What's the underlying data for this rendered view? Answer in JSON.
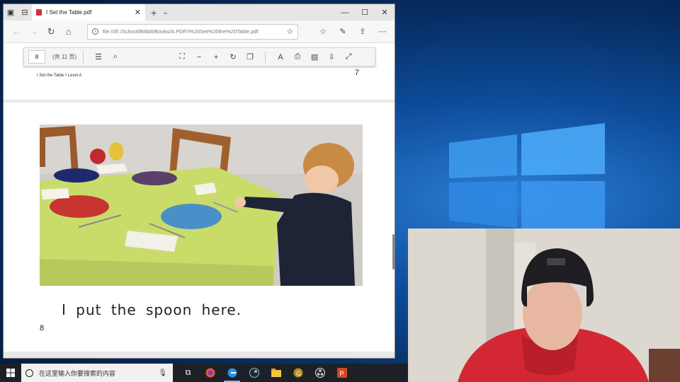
{
  "browser": {
    "tab_title": "I Set the Table.pdf",
    "url": "file:///E:/School/Bilibili/Books/A.PDF/I%20Set%20the%20Table.pdf"
  },
  "pdf_toolbar": {
    "page_input": "8",
    "page_total": "(共 11 页)"
  },
  "prev_page": {
    "header": "I Set the Table • Level A",
    "page_number": "7"
  },
  "current_page": {
    "caption": "I put the spoon here.",
    "page_number": "8"
  },
  "taskbar": {
    "search_placeholder": "在这里输入你要搜索的内容",
    "apps": [
      "task-view",
      "firefox",
      "edge",
      "steam",
      "file-explorer",
      "app-g",
      "obs",
      "powerpoint"
    ]
  },
  "colors": {
    "tablecloth": "#c9dc6a",
    "taskbar": "#1c2127",
    "wallpaper": "#0d4c9a",
    "hoodie": "#d32834"
  }
}
